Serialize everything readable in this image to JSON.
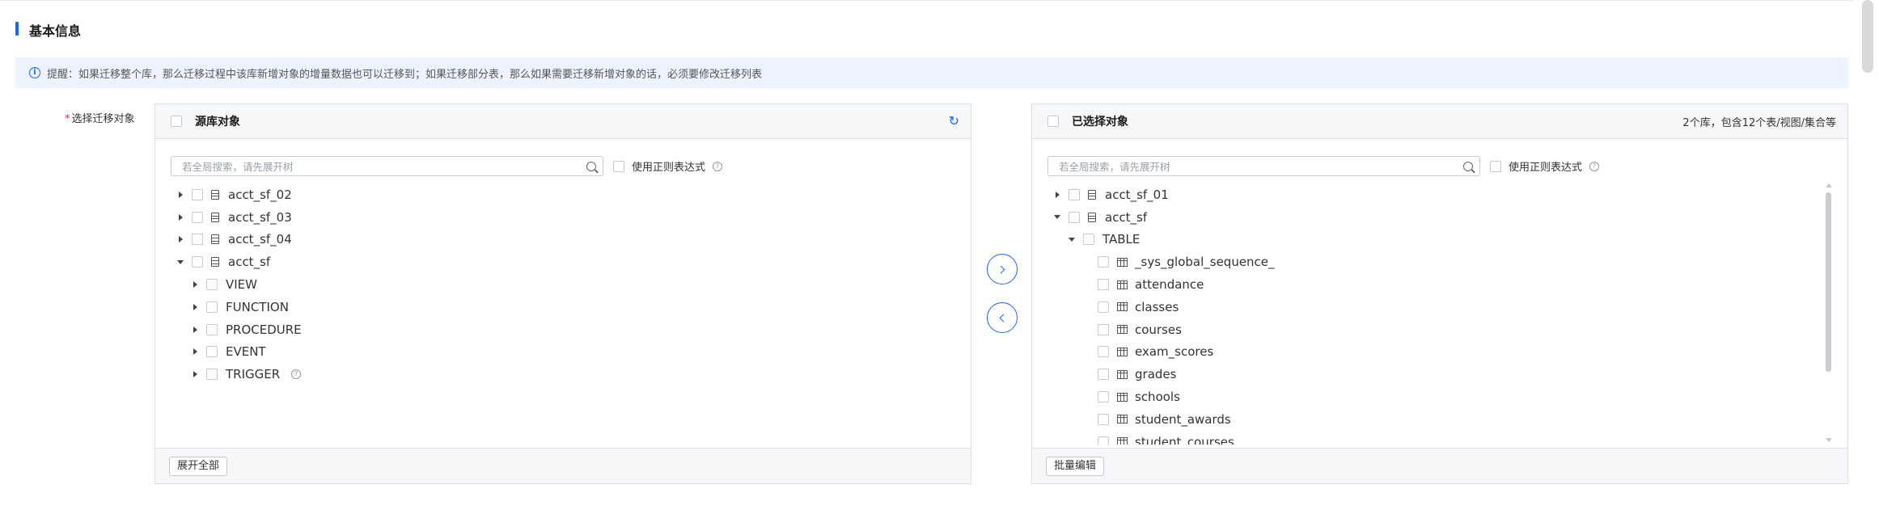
{
  "section": {
    "title": "基本信息"
  },
  "notice": {
    "text": "提醒：如果迁移整个库，那么迁移过程中该库新增对象的增量数据也可以迁移到；如果迁移部分表，那么如果需要迁移新增对象的话，必须要修改迁移列表"
  },
  "field": {
    "required_mark": "*",
    "label": "选择迁移对象"
  },
  "source_panel": {
    "title": "源库对象",
    "search_placeholder": "若全局搜索，请先展开树",
    "regex_label": "使用正则表达式",
    "tree": [
      {
        "label": "acct_sf_02",
        "icon": "database-icon",
        "expanded": false,
        "level": 0
      },
      {
        "label": "acct_sf_03",
        "icon": "database-icon",
        "expanded": false,
        "level": 0
      },
      {
        "label": "acct_sf_04",
        "icon": "database-icon",
        "expanded": false,
        "level": 0
      },
      {
        "label": "acct_sf",
        "icon": "database-icon",
        "expanded": true,
        "level": 0
      },
      {
        "label": "VIEW",
        "expanded": false,
        "level": 1
      },
      {
        "label": "FUNCTION",
        "expanded": false,
        "level": 1
      },
      {
        "label": "PROCEDURE",
        "expanded": false,
        "level": 1
      },
      {
        "label": "EVENT",
        "expanded": false,
        "level": 1
      },
      {
        "label": "TRIGGER",
        "expanded": false,
        "level": 1,
        "help": true
      }
    ],
    "footer_button": "展开全部"
  },
  "target_panel": {
    "title": "已选择对象",
    "summary": "2个库，包含12个表/视图/集合等",
    "search_placeholder": "若全局搜索，请先展开树",
    "regex_label": "使用正则表达式",
    "tree": [
      {
        "label": "acct_sf_01",
        "icon": "database-icon",
        "expanded": false,
        "level": 0
      },
      {
        "label": "acct_sf",
        "icon": "database-icon",
        "expanded": true,
        "level": 0
      },
      {
        "label": "TABLE",
        "expanded": true,
        "level": 1
      },
      {
        "label": "_sys_global_sequence_",
        "icon": "table-icon",
        "level": 2
      },
      {
        "label": "attendance",
        "icon": "table-icon",
        "level": 2
      },
      {
        "label": "classes",
        "icon": "table-icon",
        "level": 2
      },
      {
        "label": "courses",
        "icon": "table-icon",
        "level": 2
      },
      {
        "label": "exam_scores",
        "icon": "table-icon",
        "level": 2
      },
      {
        "label": "grades",
        "icon": "table-icon",
        "level": 2
      },
      {
        "label": "schools",
        "icon": "table-icon",
        "level": 2
      },
      {
        "label": "student_awards",
        "icon": "table-icon",
        "level": 2
      },
      {
        "label": "student_courses",
        "icon": "table-icon",
        "level": 2
      }
    ],
    "footer_button": "批量编辑"
  },
  "colors": {
    "accent": "#1766ff",
    "notice_bg": "#eef4ff",
    "required": "#f5222d",
    "panel_header": "#f6f7f9"
  }
}
